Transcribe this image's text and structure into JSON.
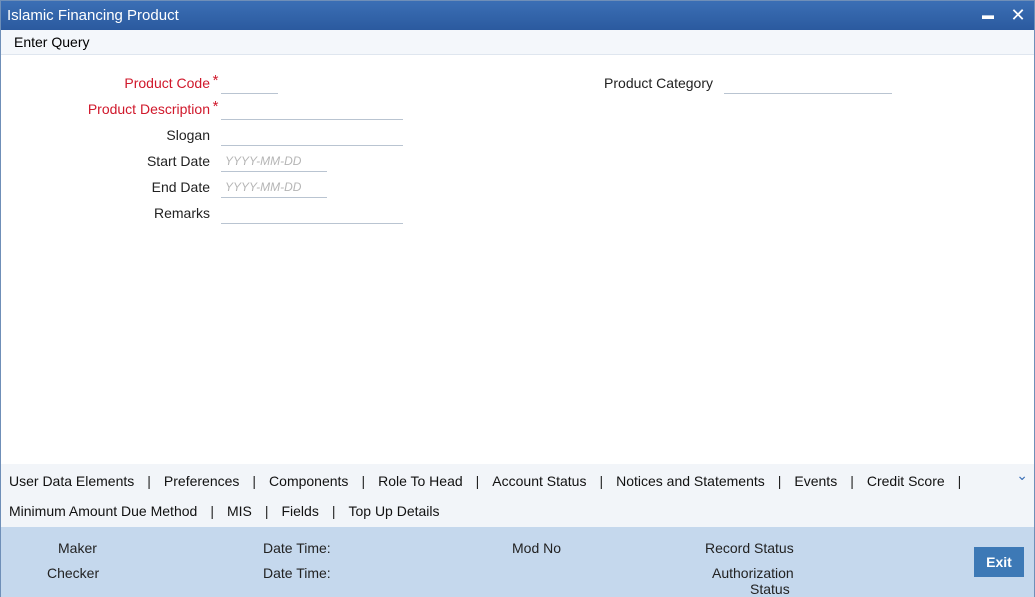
{
  "window": {
    "title": "Islamic Financing Product",
    "minimize_label": "▬",
    "close_label": "✕"
  },
  "toolbar": {
    "enter_query": "Enter Query"
  },
  "form": {
    "product_code": {
      "label": "Product Code",
      "value": ""
    },
    "product_description": {
      "label": "Product Description",
      "value": ""
    },
    "slogan": {
      "label": "Slogan",
      "value": ""
    },
    "start_date": {
      "label": "Start Date",
      "placeholder": "YYYY-MM-DD",
      "value": ""
    },
    "end_date": {
      "label": "End Date",
      "placeholder": "YYYY-MM-DD",
      "value": ""
    },
    "remarks": {
      "label": "Remarks",
      "value": ""
    },
    "product_category": {
      "label": "Product Category",
      "value": ""
    },
    "required_marker": "*"
  },
  "tabs": {
    "row1": [
      "User Data Elements",
      "Preferences",
      "Components",
      "Role To Head",
      "Account Status",
      "Notices and Statements",
      "Events",
      "Credit Score"
    ],
    "row2": [
      "Minimum Amount Due Method",
      "MIS",
      "Fields",
      "Top Up Details"
    ],
    "separator": "|",
    "expand_icon": "⌄"
  },
  "footer": {
    "maker": "Maker",
    "checker": "Checker",
    "date_time_1": "Date Time:",
    "date_time_2": "Date Time:",
    "mod_no": "Mod No",
    "record_status": "Record Status",
    "authorization_status_line1": "Authorization",
    "authorization_status_line2": "Status",
    "exit_label": "Exit"
  },
  "colors": {
    "title_bar": "#2f61a8",
    "required_label": "#d0182b",
    "footer_bg": "#c5d8ed",
    "exit_button": "#3d79b6"
  }
}
